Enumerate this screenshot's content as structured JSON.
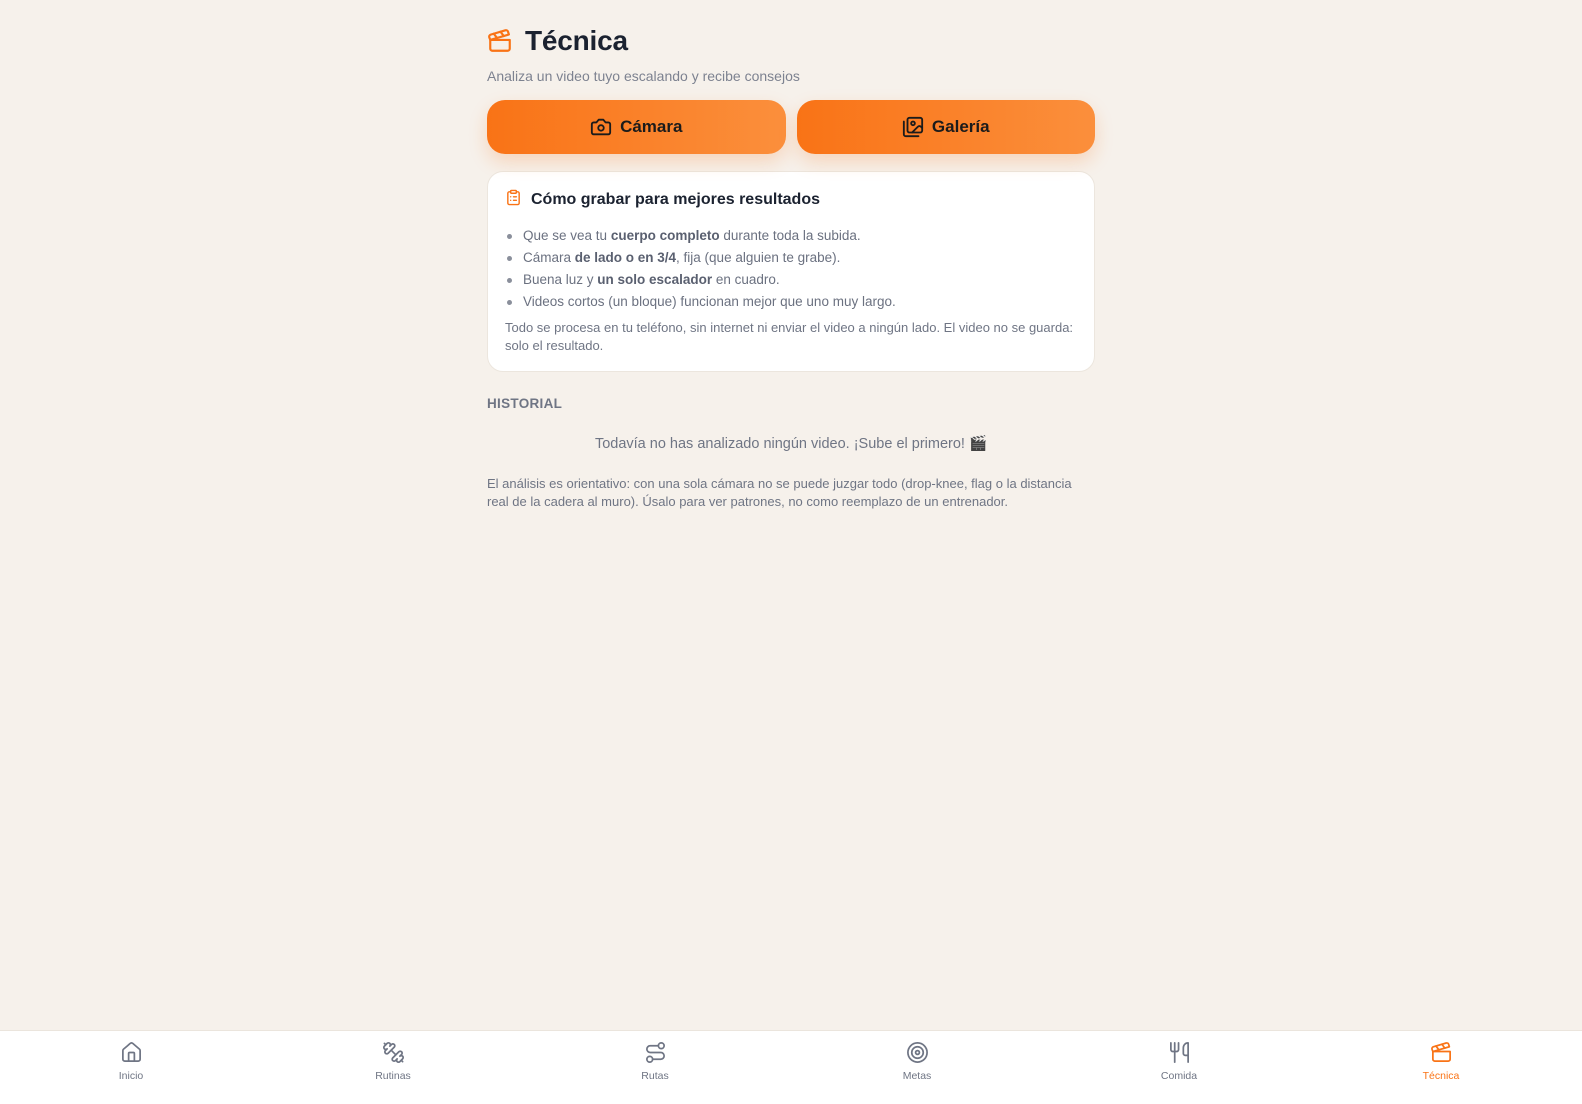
{
  "header": {
    "title": "Técnica",
    "subtitle": "Analiza un video tuyo escalando y recibe consejos"
  },
  "actions": {
    "camera_label": "Cámara",
    "gallery_label": "Galería"
  },
  "tips": {
    "title": "Cómo grabar para mejores resultados",
    "items": [
      {
        "pre": "Que se vea tu ",
        "bold": "cuerpo completo",
        "post": " durante toda la subida."
      },
      {
        "pre": "Cámara ",
        "bold": "de lado o en 3/4",
        "post": ", fija (que alguien te grabe)."
      },
      {
        "pre": "Buena luz y ",
        "bold": "un solo escalador",
        "post": " en cuadro."
      },
      {
        "pre": "Videos cortos (un bloque) funcionan mejor que uno muy largo.",
        "bold": "",
        "post": ""
      }
    ],
    "note": "Todo se procesa en tu teléfono, sin internet ni enviar el video a ningún lado. El video no se guarda: solo el resultado."
  },
  "history": {
    "label": "HISTORIAL",
    "empty_text": "Todavía no has analizado ningún video. ¡Sube el primero! 🎬"
  },
  "disclaimer": "El análisis es orientativo: con una sola cámara no se puede juzgar todo (drop-knee, flag o la distancia real de la cadera al muro). Úsalo para ver patrones, no como reemplazo de un entrenador.",
  "nav": {
    "items": [
      {
        "label": "Inicio",
        "icon": "home-icon"
      },
      {
        "label": "Rutinas",
        "icon": "dumbbell-icon"
      },
      {
        "label": "Rutas",
        "icon": "route-icon"
      },
      {
        "label": "Metas",
        "icon": "target-icon"
      },
      {
        "label": "Comida",
        "icon": "utensils-icon"
      },
      {
        "label": "Técnica",
        "icon": "clapperboard-icon"
      }
    ],
    "active_index": 5
  },
  "colors": {
    "accent": "#f97316",
    "background": "#f6f1eb",
    "text_muted": "#6f7584"
  }
}
